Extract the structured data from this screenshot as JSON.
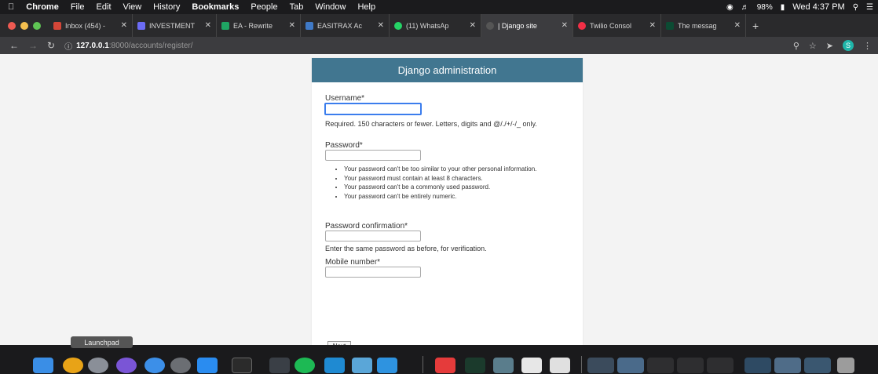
{
  "menubar": {
    "items": [
      "Chrome",
      "File",
      "Edit",
      "View",
      "History",
      "Bookmarks",
      "People",
      "Tab",
      "Window",
      "Help"
    ],
    "battery": "98%",
    "clock": "Wed 4:37 PM"
  },
  "tabs": [
    {
      "label": "Inbox (454) -",
      "active": false
    },
    {
      "label": "INVESTMENT",
      "active": false
    },
    {
      "label": "EA - Rewrite",
      "active": false
    },
    {
      "label": "EASITRAX Ac",
      "active": false
    },
    {
      "label": "(11) WhatsAp",
      "active": false
    },
    {
      "label": "| Django site",
      "active": true
    },
    {
      "label": "Twilio Consol",
      "active": false
    },
    {
      "label": "The messag",
      "active": false
    }
  ],
  "address": {
    "host": "127.0.0.1",
    "path": ":8000/accounts/register/"
  },
  "page": {
    "header": "Django administration",
    "username_label": "Username*",
    "username_help": "Required. 150 characters or fewer. Letters, digits and @/./+/-/_ only.",
    "password_label": "Password*",
    "password_rules": [
      "Your password can't be too similar to your other personal information.",
      "Your password must contain at least 8 characters.",
      "Your password can't be a commonly used password.",
      "Your password can't be entirely numeric."
    ],
    "password_confirm_label": "Password confirmation*",
    "password_confirm_help": "Enter the same password as before, for verification.",
    "mobile_label": "Mobile number*",
    "next_button": "Next"
  },
  "dock": {
    "tooltip": "Launchpad"
  },
  "colors": {
    "header_bg": "#417690",
    "focus_border": "#3b7ded"
  }
}
